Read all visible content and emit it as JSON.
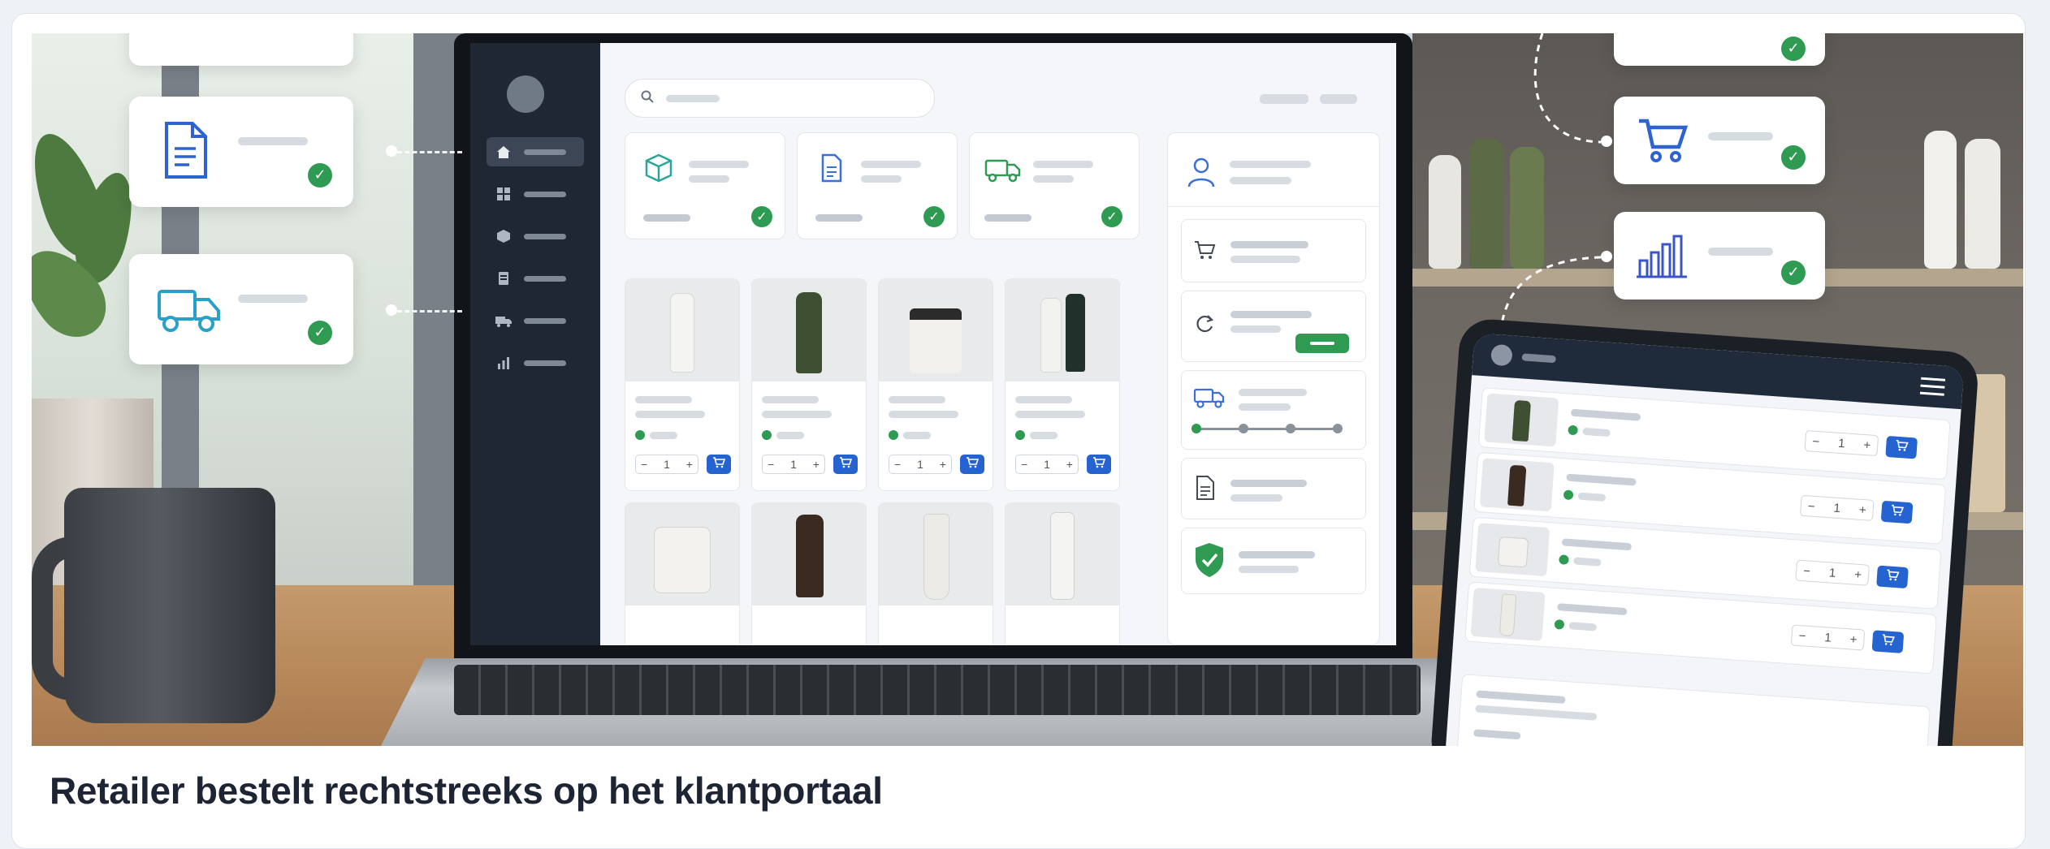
{
  "caption": "Retailer bestelt rechtstreeks op het klantportaal",
  "colors": {
    "accent_blue": "#2563d1",
    "success_green": "#2e9a52",
    "sidebar_dark": "#1f2733",
    "icon_blue": "#3b6fd6"
  },
  "laptop": {
    "sidebar_icons": [
      "home-icon",
      "grid-icon",
      "box-icon",
      "document-icon",
      "truck-icon",
      "bar-chart-icon"
    ],
    "status_tiles": [
      "box-icon",
      "document-icon",
      "truck-icon"
    ],
    "product_quantities": [
      "1",
      "1",
      "1",
      "1"
    ],
    "right_panel_icons": [
      "user-icon",
      "cart-icon",
      "refresh-icon",
      "truck-icon",
      "document-icon",
      "shield-check-icon"
    ]
  },
  "floating_cards": {
    "left": [
      "document-icon",
      "truck-icon"
    ],
    "right": [
      "cart-icon",
      "bar-chart-icon"
    ]
  },
  "tablet": {
    "quantities": [
      "1",
      "1",
      "1",
      "1"
    ]
  }
}
